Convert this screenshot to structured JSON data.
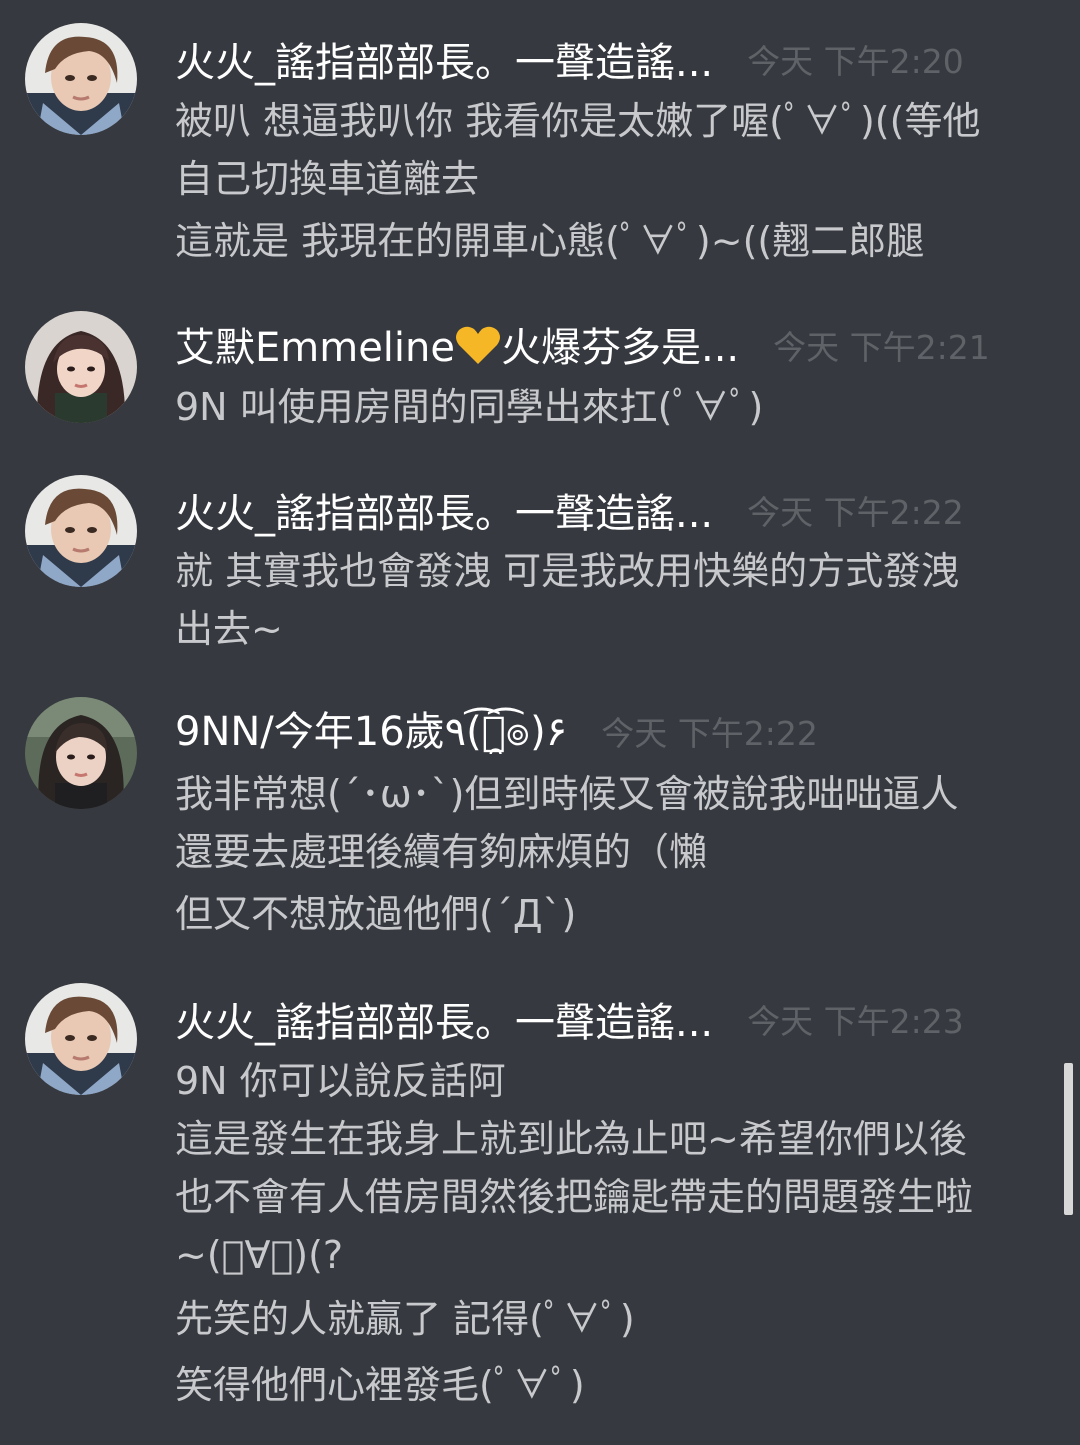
{
  "colors": {
    "background": "#36393f",
    "username": "#ffffff",
    "message_text": "#c8c9cc",
    "timestamp": "#5f6368",
    "heart": "#f5b726",
    "scrollbar": "#d8d8d8"
  },
  "messages": [
    {
      "author": "火火_謠指部部長。一聲造謠...",
      "timestamp": "今天 下午2:20",
      "avatar": "avatar-photo-huohuo",
      "lines": [
        "被叭 想逼我叭你 我看你是太嫩了喔(ﾟ∀ﾟ)((等他",
        "自己切換車道離去",
        "這就是 我現在的開車心態(ﾟ∀ﾟ)~((翹二郎腿"
      ]
    },
    {
      "author_prefix": "艾默Emmeline",
      "author_icon": "yellow-heart-icon",
      "author_suffix": "火爆芬多是...",
      "timestamp": "今天 下午2:21",
      "avatar": "avatar-photo-emmeline",
      "lines": [
        "9N 叫使用房間的同學出來扛(ﾟ∀ﾟ)"
      ]
    },
    {
      "author": "火火_謠指部部長。一聲造謠...",
      "timestamp": "今天 下午2:22",
      "avatar": "avatar-photo-huohuo",
      "lines": [
        "就 其實我也會發洩 可是我改用快樂的方式發洩",
        "出去~"
      ]
    },
    {
      "author": "9NN/今年16歲٩(͡๏̯͡๏)۶",
      "timestamp": "今天 下午2:22",
      "avatar": "avatar-photo-9nn",
      "lines": [
        "我非常想(´･ω･`)但到時候又會被說我咄咄逼人",
        "還要去處理後續有夠麻煩的（懶",
        "但又不想放過他們(´Д`)"
      ]
    },
    {
      "author": "火火_謠指部部長。一聲造謠...",
      "timestamp": "今天 下午2:23",
      "avatar": "avatar-photo-huohuo",
      "lines": [
        "9N 你可以說反話阿",
        "這是發生在我身上就到此為止吧~希望你們以後",
        "也不會有人借房間然後把鑰匙帶走的問題發生啦",
        "~(ﾟ∀ﾟ)(?",
        "先笑的人就贏了 記得(ﾟ∀ﾟ)",
        "笑得他們心裡發毛(ﾟ∀ﾟ)"
      ]
    }
  ]
}
